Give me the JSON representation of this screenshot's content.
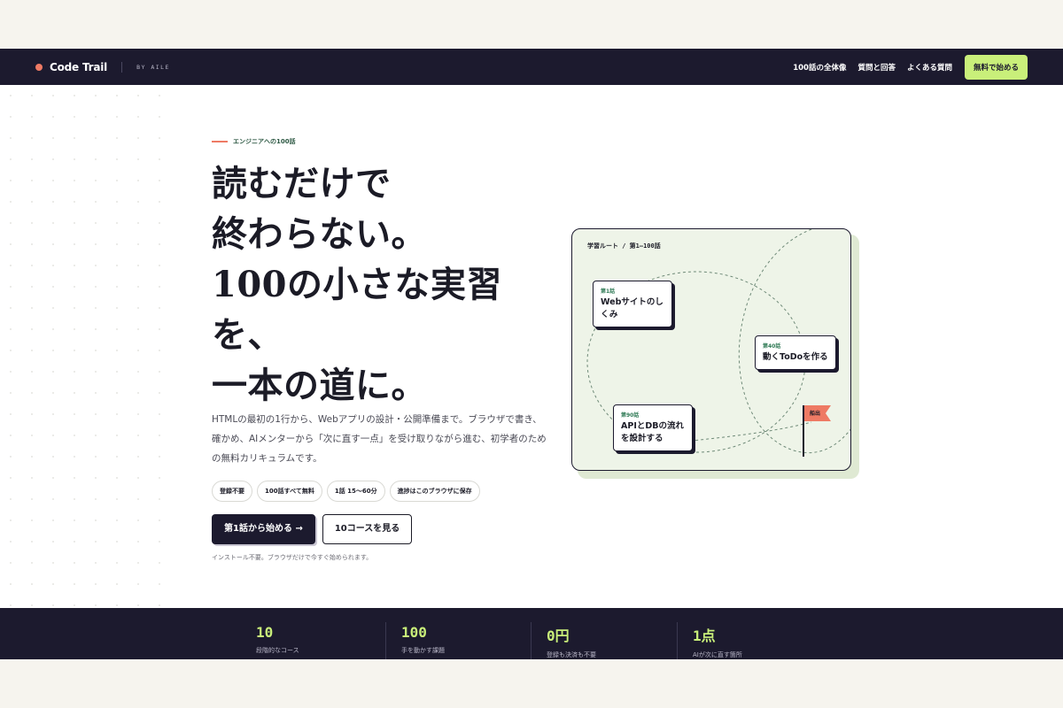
{
  "nav": {
    "brand": "Code Trail",
    "by": "BY AILE",
    "links": [
      "100話の全体像",
      "質問と回答",
      "よくある質問"
    ],
    "cta": "無料で始める"
  },
  "hero": {
    "eyebrow": "エンジニアへの100話",
    "headline": [
      "読むだけで",
      "終わらない。",
      "100の小さな実習",
      "を、",
      "一本の道に。"
    ],
    "lead": "HTMLの最初の1行から、Webアプリの設計・公開準備まで。ブラウザで書き、確かめ、AIメンターから「次に直す一点」を受け取りながら進む、初学者のための無料カリキュラムです。",
    "tags": [
      "登録不要",
      "100話すべて無料",
      "1話 15〜60分",
      "進捗はこのブラウザに保存"
    ],
    "primary_cta": "第1話から始める →",
    "secondary_cta": "10コースを見る",
    "note": "インストール不要。ブラウザだけで今すぐ始められます。"
  },
  "route": {
    "title": "学習ルート / 第1–100話",
    "stops": [
      {
        "num": "第1話",
        "title": "Webサイトのしくみ"
      },
      {
        "num": "第40話",
        "title": "動くToDoを作る"
      },
      {
        "num": "第90話",
        "title": "APIとDBの流れを設計する"
      }
    ],
    "flag": "船出"
  },
  "stats": [
    {
      "value": "10",
      "label": "段階的なコース"
    },
    {
      "value": "100",
      "label": "手を動かす課題"
    },
    {
      "value": "0円",
      "label": "登録も決済も不要"
    },
    {
      "value": "1点",
      "label": "AIが次に直す箇所"
    }
  ],
  "colors": {
    "navy": "#1c1a2e",
    "lime": "#c9ef7a",
    "coral": "#ee7a64",
    "mint": "#eef4e8"
  }
}
